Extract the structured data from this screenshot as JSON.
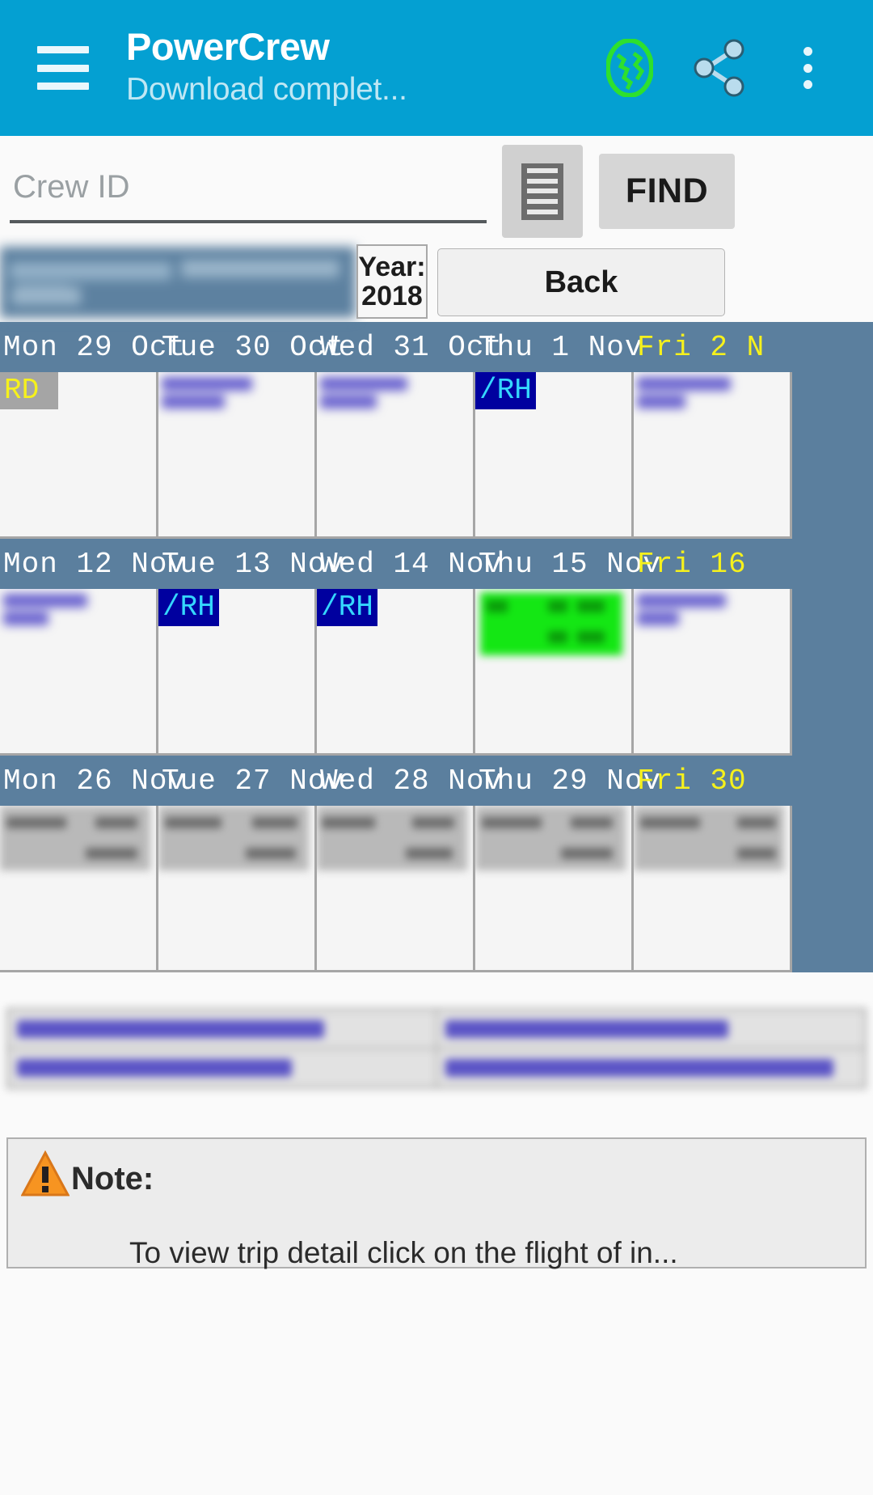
{
  "appbar": {
    "menu_icon": "hamburger-menu-icon",
    "title": "PowerCrew",
    "subtitle": "Download complet...",
    "globe_icon": "globe-icon",
    "share_icon": "share-icon",
    "overflow_icon": "kebab-menu-icon",
    "background_color": "#04A0D2",
    "title_color": "#FFFFFF",
    "subtitle_color": "#BFE7F4"
  },
  "search": {
    "input_value": "",
    "placeholder": "Crew ID",
    "document_button_icon": "document-list-icon",
    "find_label": "FIND"
  },
  "info": {
    "crew_name_redacted": true,
    "year_label": "Year:",
    "year_value": "2018",
    "back_label": "Back"
  },
  "calendar": {
    "header_bg": "#5B7F9E",
    "weekday_color": "#FFFFFF",
    "friday_color": "#F6F11C",
    "weeks": [
      {
        "days": [
          {
            "weekday": "Mon",
            "date": "29",
            "month": "Oct",
            "highlight": false
          },
          {
            "weekday": "Tue",
            "date": "30",
            "month": "Oct",
            "highlight": false
          },
          {
            "weekday": "Wed",
            "date": "31",
            "month": "Oct",
            "highlight": false
          },
          {
            "weekday": "Thu",
            "date": "1",
            "month": "Nov",
            "highlight": false
          },
          {
            "weekday": "Fri",
            "date": "2",
            "month": "N",
            "highlight": true
          }
        ],
        "cells": [
          {
            "badge": "RD",
            "badge_style": "rd",
            "redacted": false
          },
          {
            "badge": "",
            "badge_style": "none",
            "redacted": true
          },
          {
            "badge": "",
            "badge_style": "none",
            "redacted": true
          },
          {
            "badge": "/RH",
            "badge_style": "rh",
            "redacted": false
          },
          {
            "badge": "",
            "badge_style": "none",
            "redacted": true
          }
        ]
      },
      {
        "days": [
          {
            "weekday": "Mon",
            "date": "12",
            "month": "Nov",
            "highlight": false
          },
          {
            "weekday": "Tue",
            "date": "13",
            "month": "Nov",
            "highlight": false
          },
          {
            "weekday": "Wed",
            "date": "14",
            "month": "Nov",
            "highlight": false
          },
          {
            "weekday": "Thu",
            "date": "15",
            "month": "Nov",
            "highlight": false
          },
          {
            "weekday": "Fri",
            "date": "16",
            "month": "",
            "highlight": true
          }
        ],
        "cells": [
          {
            "badge": "",
            "badge_style": "none",
            "redacted": true
          },
          {
            "badge": "/RH",
            "badge_style": "rh",
            "redacted": false
          },
          {
            "badge": "/RH",
            "badge_style": "rh",
            "redacted": false
          },
          {
            "badge": "",
            "badge_style": "green",
            "redacted": true
          },
          {
            "badge": "",
            "badge_style": "none",
            "redacted": true
          }
        ]
      },
      {
        "days": [
          {
            "weekday": "Mon",
            "date": "26",
            "month": "Nov",
            "highlight": false
          },
          {
            "weekday": "Tue",
            "date": "27",
            "month": "Nov",
            "highlight": false
          },
          {
            "weekday": "Wed",
            "date": "28",
            "month": "Nov",
            "highlight": false
          },
          {
            "weekday": "Thu",
            "date": "29",
            "month": "Nov",
            "highlight": false
          },
          {
            "weekday": "Fri",
            "date": "30",
            "month": "",
            "highlight": true
          }
        ],
        "cells": [
          {
            "badge": "",
            "badge_style": "gray",
            "redacted": true
          },
          {
            "badge": "",
            "badge_style": "gray",
            "redacted": true
          },
          {
            "badge": "",
            "badge_style": "gray",
            "redacted": true
          },
          {
            "badge": "",
            "badge_style": "gray",
            "redacted": true
          },
          {
            "badge": "",
            "badge_style": "gray",
            "redacted": true
          }
        ]
      }
    ],
    "badge_colors": {
      "rest_day_bg": "#A5A5A5",
      "rest_day_text": "#F6F11C",
      "rh_bg": "#00009F",
      "rh_text": "#35D7FD",
      "green_bg": "#14E714"
    }
  },
  "links": {
    "redacted": true,
    "items": [
      {
        "id": "link-1",
        "redacted": true
      },
      {
        "id": "link-2",
        "redacted": true
      },
      {
        "id": "link-3",
        "redacted": true
      },
      {
        "id": "link-4",
        "redacted": true
      }
    ]
  },
  "note": {
    "warning_icon": "warning-triangle-icon",
    "label": "Note:",
    "body": "To view trip detail click on the flight of in..."
  }
}
